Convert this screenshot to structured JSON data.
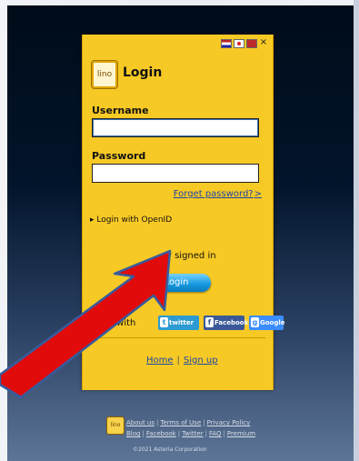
{
  "page": {
    "title": "Login",
    "logo_text": "lino",
    "language_icons": [
      "flag-us-icon",
      "flag-jp-icon",
      "flag-cn-icon",
      "close-icon"
    ]
  },
  "form": {
    "username_label": "Username",
    "password_label": "Password",
    "forgot_password": "Forget password?",
    "forgot_caret": ">",
    "openid_label": "Login with OpenID",
    "openid_caret": "▸",
    "stay_signed_in": "y signed in",
    "login_button": "Login"
  },
  "social": {
    "label": "Login with",
    "twitter": "twitter",
    "facebook": "Facebook",
    "google": "Google"
  },
  "links": {
    "home": "Home",
    "separator": "|",
    "signup": "Sign up"
  },
  "footer": {
    "logo_text": "lino",
    "about": "About us",
    "terms": "Terms of Use",
    "privacy": "Privacy Policy",
    "blog": "Blog",
    "facebook": "Facebook",
    "twitter": "Twitter",
    "faq": "FAQ",
    "premium": "Premium",
    "separator": "|",
    "copyright": "©2021 Asteria Corporation"
  },
  "colors": {
    "panel": "#f7c925",
    "link": "#1e46a5",
    "button": "#1497de",
    "annotation_arrow": "#e10b0b"
  }
}
